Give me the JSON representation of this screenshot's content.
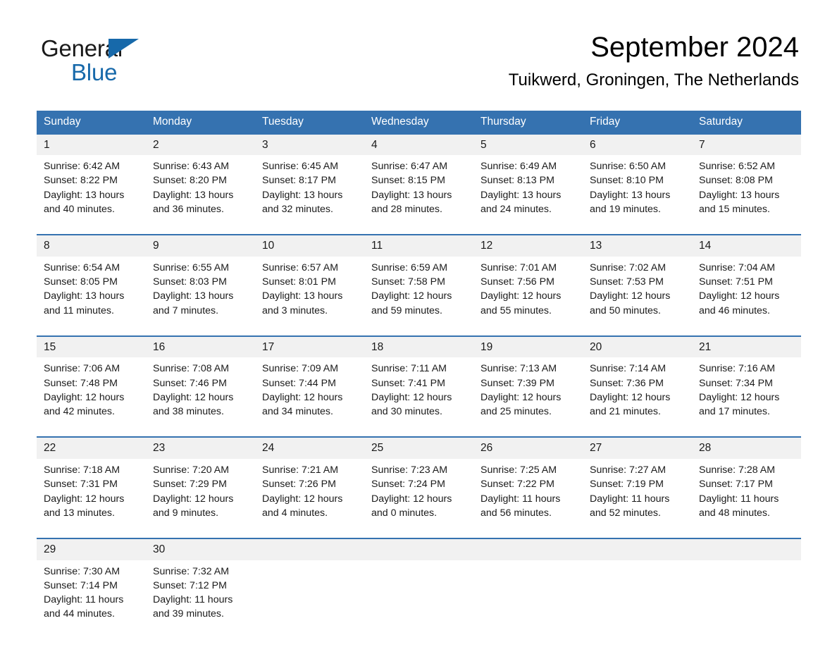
{
  "brand": {
    "name_part1": "General",
    "name_part2": "Blue",
    "triangle_color": "#1769aa"
  },
  "header": {
    "month_title": "September 2024",
    "location": "Tuikwerd, Groningen, The Netherlands"
  },
  "theme": {
    "header_blue": "#3572b0",
    "date_row_gray": "#f1f1f1",
    "text_color": "#1a1a1a"
  },
  "calendar": {
    "weekday_headers": [
      "Sunday",
      "Monday",
      "Tuesday",
      "Wednesday",
      "Thursday",
      "Friday",
      "Saturday"
    ],
    "weeks": [
      {
        "dates": [
          "1",
          "2",
          "3",
          "4",
          "5",
          "6",
          "7"
        ],
        "cells": [
          {
            "sunrise": "Sunrise: 6:42 AM",
            "sunset": "Sunset: 8:22 PM",
            "daylight1": "Daylight: 13 hours",
            "daylight2": "and 40 minutes."
          },
          {
            "sunrise": "Sunrise: 6:43 AM",
            "sunset": "Sunset: 8:20 PM",
            "daylight1": "Daylight: 13 hours",
            "daylight2": "and 36 minutes."
          },
          {
            "sunrise": "Sunrise: 6:45 AM",
            "sunset": "Sunset: 8:17 PM",
            "daylight1": "Daylight: 13 hours",
            "daylight2": "and 32 minutes."
          },
          {
            "sunrise": "Sunrise: 6:47 AM",
            "sunset": "Sunset: 8:15 PM",
            "daylight1": "Daylight: 13 hours",
            "daylight2": "and 28 minutes."
          },
          {
            "sunrise": "Sunrise: 6:49 AM",
            "sunset": "Sunset: 8:13 PM",
            "daylight1": "Daylight: 13 hours",
            "daylight2": "and 24 minutes."
          },
          {
            "sunrise": "Sunrise: 6:50 AM",
            "sunset": "Sunset: 8:10 PM",
            "daylight1": "Daylight: 13 hours",
            "daylight2": "and 19 minutes."
          },
          {
            "sunrise": "Sunrise: 6:52 AM",
            "sunset": "Sunset: 8:08 PM",
            "daylight1": "Daylight: 13 hours",
            "daylight2": "and 15 minutes."
          }
        ]
      },
      {
        "dates": [
          "8",
          "9",
          "10",
          "11",
          "12",
          "13",
          "14"
        ],
        "cells": [
          {
            "sunrise": "Sunrise: 6:54 AM",
            "sunset": "Sunset: 8:05 PM",
            "daylight1": "Daylight: 13 hours",
            "daylight2": "and 11 minutes."
          },
          {
            "sunrise": "Sunrise: 6:55 AM",
            "sunset": "Sunset: 8:03 PM",
            "daylight1": "Daylight: 13 hours",
            "daylight2": "and 7 minutes."
          },
          {
            "sunrise": "Sunrise: 6:57 AM",
            "sunset": "Sunset: 8:01 PM",
            "daylight1": "Daylight: 13 hours",
            "daylight2": "and 3 minutes."
          },
          {
            "sunrise": "Sunrise: 6:59 AM",
            "sunset": "Sunset: 7:58 PM",
            "daylight1": "Daylight: 12 hours",
            "daylight2": "and 59 minutes."
          },
          {
            "sunrise": "Sunrise: 7:01 AM",
            "sunset": "Sunset: 7:56 PM",
            "daylight1": "Daylight: 12 hours",
            "daylight2": "and 55 minutes."
          },
          {
            "sunrise": "Sunrise: 7:02 AM",
            "sunset": "Sunset: 7:53 PM",
            "daylight1": "Daylight: 12 hours",
            "daylight2": "and 50 minutes."
          },
          {
            "sunrise": "Sunrise: 7:04 AM",
            "sunset": "Sunset: 7:51 PM",
            "daylight1": "Daylight: 12 hours",
            "daylight2": "and 46 minutes."
          }
        ]
      },
      {
        "dates": [
          "15",
          "16",
          "17",
          "18",
          "19",
          "20",
          "21"
        ],
        "cells": [
          {
            "sunrise": "Sunrise: 7:06 AM",
            "sunset": "Sunset: 7:48 PM",
            "daylight1": "Daylight: 12 hours",
            "daylight2": "and 42 minutes."
          },
          {
            "sunrise": "Sunrise: 7:08 AM",
            "sunset": "Sunset: 7:46 PM",
            "daylight1": "Daylight: 12 hours",
            "daylight2": "and 38 minutes."
          },
          {
            "sunrise": "Sunrise: 7:09 AM",
            "sunset": "Sunset: 7:44 PM",
            "daylight1": "Daylight: 12 hours",
            "daylight2": "and 34 minutes."
          },
          {
            "sunrise": "Sunrise: 7:11 AM",
            "sunset": "Sunset: 7:41 PM",
            "daylight1": "Daylight: 12 hours",
            "daylight2": "and 30 minutes."
          },
          {
            "sunrise": "Sunrise: 7:13 AM",
            "sunset": "Sunset: 7:39 PM",
            "daylight1": "Daylight: 12 hours",
            "daylight2": "and 25 minutes."
          },
          {
            "sunrise": "Sunrise: 7:14 AM",
            "sunset": "Sunset: 7:36 PM",
            "daylight1": "Daylight: 12 hours",
            "daylight2": "and 21 minutes."
          },
          {
            "sunrise": "Sunrise: 7:16 AM",
            "sunset": "Sunset: 7:34 PM",
            "daylight1": "Daylight: 12 hours",
            "daylight2": "and 17 minutes."
          }
        ]
      },
      {
        "dates": [
          "22",
          "23",
          "24",
          "25",
          "26",
          "27",
          "28"
        ],
        "cells": [
          {
            "sunrise": "Sunrise: 7:18 AM",
            "sunset": "Sunset: 7:31 PM",
            "daylight1": "Daylight: 12 hours",
            "daylight2": "and 13 minutes."
          },
          {
            "sunrise": "Sunrise: 7:20 AM",
            "sunset": "Sunset: 7:29 PM",
            "daylight1": "Daylight: 12 hours",
            "daylight2": "and 9 minutes."
          },
          {
            "sunrise": "Sunrise: 7:21 AM",
            "sunset": "Sunset: 7:26 PM",
            "daylight1": "Daylight: 12 hours",
            "daylight2": "and 4 minutes."
          },
          {
            "sunrise": "Sunrise: 7:23 AM",
            "sunset": "Sunset: 7:24 PM",
            "daylight1": "Daylight: 12 hours",
            "daylight2": "and 0 minutes."
          },
          {
            "sunrise": "Sunrise: 7:25 AM",
            "sunset": "Sunset: 7:22 PM",
            "daylight1": "Daylight: 11 hours",
            "daylight2": "and 56 minutes."
          },
          {
            "sunrise": "Sunrise: 7:27 AM",
            "sunset": "Sunset: 7:19 PM",
            "daylight1": "Daylight: 11 hours",
            "daylight2": "and 52 minutes."
          },
          {
            "sunrise": "Sunrise: 7:28 AM",
            "sunset": "Sunset: 7:17 PM",
            "daylight1": "Daylight: 11 hours",
            "daylight2": "and 48 minutes."
          }
        ]
      },
      {
        "dates": [
          "29",
          "30",
          "",
          "",
          "",
          "",
          ""
        ],
        "cells": [
          {
            "sunrise": "Sunrise: 7:30 AM",
            "sunset": "Sunset: 7:14 PM",
            "daylight1": "Daylight: 11 hours",
            "daylight2": "and 44 minutes."
          },
          {
            "sunrise": "Sunrise: 7:32 AM",
            "sunset": "Sunset: 7:12 PM",
            "daylight1": "Daylight: 11 hours",
            "daylight2": "and 39 minutes."
          },
          {
            "sunrise": "",
            "sunset": "",
            "daylight1": "",
            "daylight2": ""
          },
          {
            "sunrise": "",
            "sunset": "",
            "daylight1": "",
            "daylight2": ""
          },
          {
            "sunrise": "",
            "sunset": "",
            "daylight1": "",
            "daylight2": ""
          },
          {
            "sunrise": "",
            "sunset": "",
            "daylight1": "",
            "daylight2": ""
          },
          {
            "sunrise": "",
            "sunset": "",
            "daylight1": "",
            "daylight2": ""
          }
        ]
      }
    ]
  }
}
